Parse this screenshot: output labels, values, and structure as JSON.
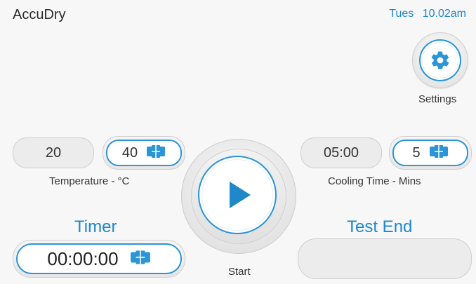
{
  "header": {
    "app_name": "AccuDry",
    "day": "Tues",
    "time": "10.02am"
  },
  "settings": {
    "label": "Settings",
    "icon": "gear-icon"
  },
  "temperature": {
    "current_value": "20",
    "setpoint_value": "40",
    "label": "Temperature - °C",
    "stepper_icon": "stepper-icon"
  },
  "cooling": {
    "current_value": "05:00",
    "setpoint_value": "5",
    "label": "Cooling Time - Mins",
    "stepper_icon": "stepper-icon"
  },
  "start": {
    "label": "Start",
    "icon": "play-icon"
  },
  "timer": {
    "heading": "Timer",
    "value": "00:00:00",
    "stepper_icon": "stepper-icon"
  },
  "test_end": {
    "heading": "Test End",
    "value": ""
  },
  "colors": {
    "accent": "#1e88c9",
    "accent_border": "#2b95d6",
    "background": "#f7f7f7",
    "box_fill": "#ececec"
  }
}
